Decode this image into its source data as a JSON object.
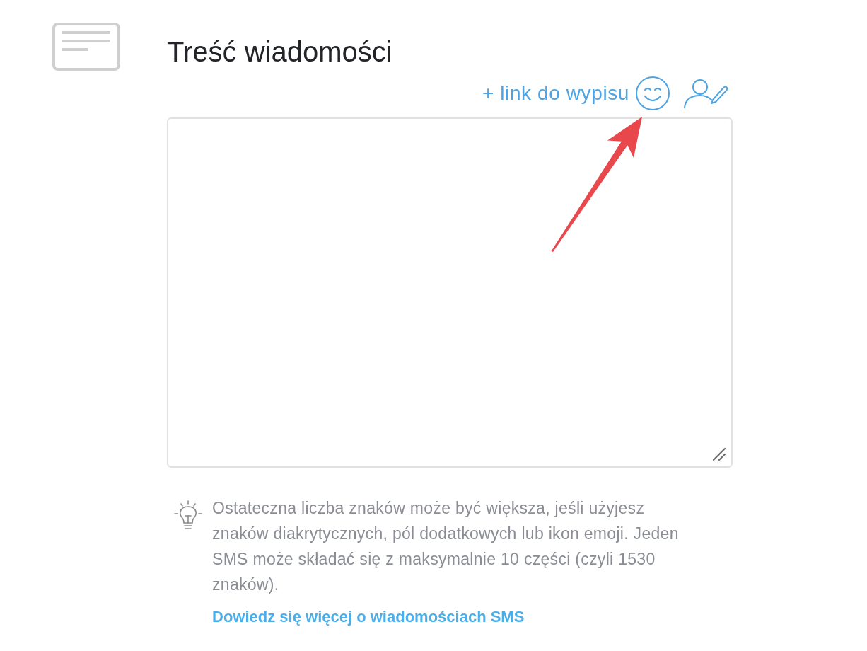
{
  "header": {
    "title": "Treść wiadomości"
  },
  "toolbar": {
    "unsubscribe_link": "+ link do wypisu"
  },
  "hint": {
    "text": "Ostateczna liczba znaków może być większa, jeśli użyjesz znaków diakrytycznych, pól dodatkowych lub ikon emoji. Jeden SMS może składać się z maksymalnie 10 części (czyli 1530 znaków).",
    "link": "Dowiedz się więcej o wiadomościach SMS"
  },
  "annotations": [
    {
      "kind": "arrow"
    }
  ]
}
